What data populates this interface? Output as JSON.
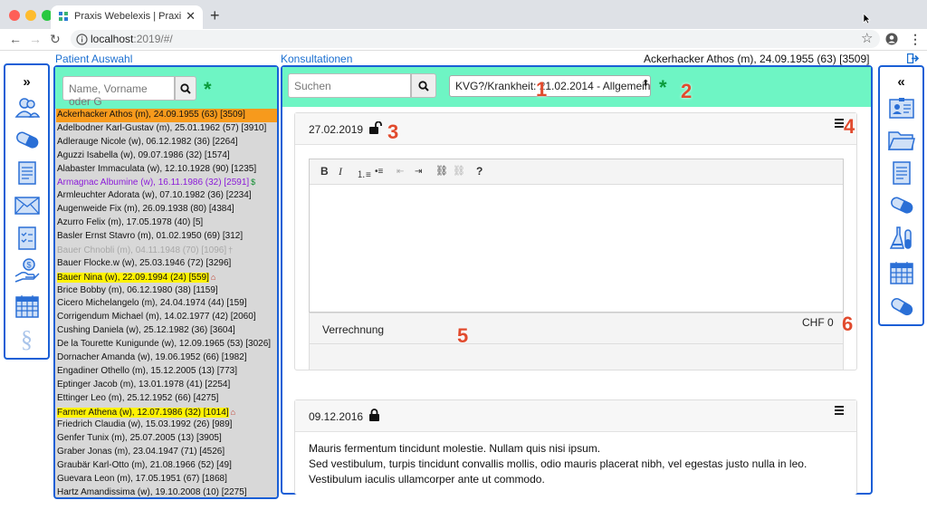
{
  "browser": {
    "tab_title": "Praxis Webelexis | Praxis Webe",
    "url_host": "localhost",
    "url_rest": ":2019/#/"
  },
  "headers": {
    "patient_section": "Patient Auswahl",
    "consult_section": "Konsultationen",
    "current_patient": "Ackerhacker Athos (m), 24.09.1955 (63) [3509]"
  },
  "patient_search": {
    "placeholder": "Name, Vorname oder G"
  },
  "consult_search": {
    "placeholder": "Suchen"
  },
  "case_select": {
    "value": "KVG?/Krankheit: 21.02.2014 - Allgemein"
  },
  "patients": [
    {
      "text": "Ackerhacker Athos (m), 24.09.1955 (63) [3509]",
      "style": "sel",
      "badge": ""
    },
    {
      "text": "Adelbodner Karl-Gustav (m), 25.01.1962 (57) [3910]",
      "style": "",
      "badge": ""
    },
    {
      "text": "Adlerauge Nicole (w), 06.12.1982 (36) [2264]",
      "style": "",
      "badge": ""
    },
    {
      "text": "Aguzzi Isabella (w), 09.07.1986 (32) [1574]",
      "style": "",
      "badge": ""
    },
    {
      "text": "Alabaster Immaculata (w), 12.10.1928 (90) [1235]",
      "style": "",
      "badge": ""
    },
    {
      "text": "Armagnac Albumine (w), 16.11.1986 (32) [2591]",
      "style": "purple",
      "badge": "$"
    },
    {
      "text": "Armleuchter Adorata (w), 07.10.1982 (36) [2234]",
      "style": "",
      "badge": ""
    },
    {
      "text": "Augenweide Fix (m), 26.09.1938 (80) [4384]",
      "style": "",
      "badge": ""
    },
    {
      "text": "Azurro Felix (m), 17.05.1978 (40) [5]",
      "style": "",
      "badge": ""
    },
    {
      "text": "Basler Ernst Stavro (m), 01.02.1950 (69) [312]",
      "style": "",
      "badge": ""
    },
    {
      "text": "Bauer Chnobli (m), 04.11.1948 (70) [1096]",
      "style": "grey",
      "badge": "†"
    },
    {
      "text": "Bauer Flocke.w (w), 25.03.1946 (72) [3296]",
      "style": "",
      "badge": ""
    },
    {
      "text": "Bauer Nina (w), 22.09.1994 (24) [559]",
      "style": "yellow",
      "badge": "⌂"
    },
    {
      "text": "Brice Bobby (m), 06.12.1980 (38) [1159]",
      "style": "",
      "badge": ""
    },
    {
      "text": "Cicero Michelangelo (m), 24.04.1974 (44) [159]",
      "style": "",
      "badge": ""
    },
    {
      "text": "Corrigendum Michael (m), 14.02.1977 (42) [2060]",
      "style": "",
      "badge": ""
    },
    {
      "text": "Cushing Daniela (w), 25.12.1982 (36) [3604]",
      "style": "",
      "badge": ""
    },
    {
      "text": "De la Tourette Kunigunde (w), 12.09.1965 (53) [3026]",
      "style": "",
      "badge": ""
    },
    {
      "text": "Dornacher Amanda (w), 19.06.1952 (66) [1982]",
      "style": "",
      "badge": ""
    },
    {
      "text": "Engadiner Othello (m), 15.12.2005 (13) [773]",
      "style": "",
      "badge": ""
    },
    {
      "text": "Eptinger Jacob (m), 13.01.1978 (41) [2254]",
      "style": "",
      "badge": ""
    },
    {
      "text": "Ettinger Leo (m), 25.12.1952 (66) [4275]",
      "style": "",
      "badge": ""
    },
    {
      "text": "Farmer Athena (w), 12.07.1986 (32) [1014]",
      "style": "yellow",
      "badge": "⌂"
    },
    {
      "text": "Friedrich Claudia (w), 15.03.1992 (26) [989]",
      "style": "",
      "badge": ""
    },
    {
      "text": "Genfer Tunix (m), 25.07.2005 (13) [3905]",
      "style": "",
      "badge": ""
    },
    {
      "text": "Graber Jonas (m), 23.04.1947 (71) [4526]",
      "style": "",
      "badge": ""
    },
    {
      "text": "Graubär Karl-Otto (m), 21.08.1966 (52) [49]",
      "style": "",
      "badge": ""
    },
    {
      "text": "Guevara Leon (m), 17.05.1951 (67) [1868]",
      "style": "",
      "badge": ""
    },
    {
      "text": "Hartz Amandissima (w), 19.10.2008 (10) [2275]",
      "style": "",
      "badge": ""
    }
  ],
  "consultations": [
    {
      "date": "27.02.2019",
      "lock": "unlocked"
    },
    {
      "date": "09.12.2016",
      "lock": "locked",
      "text1": "Mauris fermentum tincidunt molestie. Nullam quis nisi ipsum.",
      "text2": "Sed vestibulum, turpis tincidunt convallis mollis, odio mauris placerat nibh, vel egestas justo nulla in leo. Vestibulum iaculis ullamcorper ante ut commodo."
    }
  ],
  "billing": {
    "label": "Verrechnung",
    "amount": "CHF 0"
  },
  "callouts": [
    "1",
    "2",
    "3",
    "4",
    "5",
    "6"
  ],
  "colors": {
    "accent_blue": "#1a5fd6",
    "header_green": "#6ef5c4",
    "selected_orange": "#f79a1c",
    "callout_red": "#e14b2e"
  }
}
